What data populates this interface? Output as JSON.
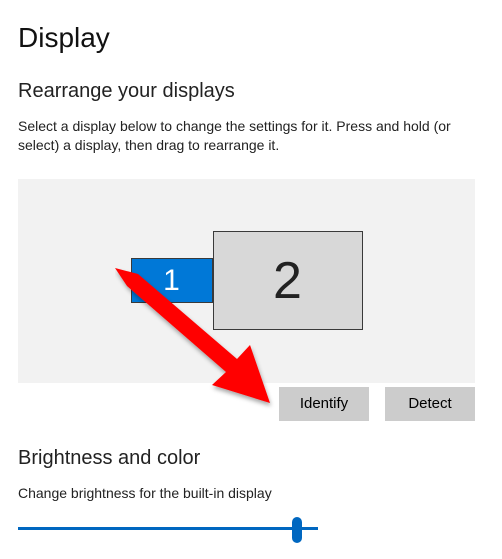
{
  "page": {
    "title": "Display"
  },
  "rearrange": {
    "heading": "Rearrange your displays",
    "description": "Select a display below to change the settings for it. Press and hold (or select) a display, then drag to rearrange it.",
    "displays": [
      "1",
      "2"
    ],
    "identify_label": "Identify",
    "detect_label": "Detect"
  },
  "brightness": {
    "heading": "Brightness and color",
    "slider_label": "Change brightness for the built-in display"
  }
}
